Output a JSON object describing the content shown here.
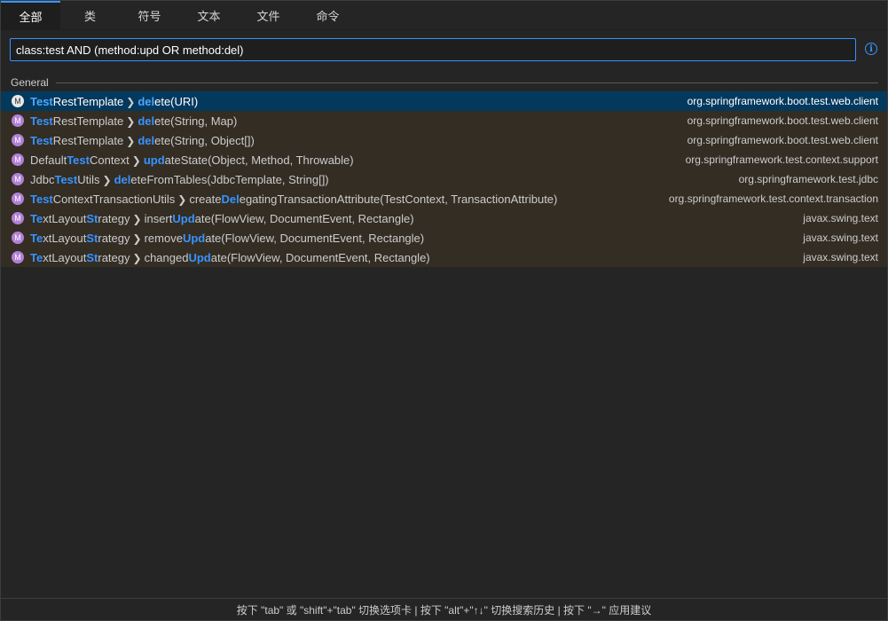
{
  "tabs": [
    {
      "label": "全部",
      "active": true
    },
    {
      "label": "类"
    },
    {
      "label": "符号"
    },
    {
      "label": "文本"
    },
    {
      "label": "文件"
    },
    {
      "label": "命令"
    }
  ],
  "search": {
    "value": "class:test AND (method:upd OR method:del)"
  },
  "icons": {
    "info": "info-icon",
    "method": "method-icon"
  },
  "group": {
    "label": "General"
  },
  "results": [
    {
      "icon_letter": "M",
      "class_parts": [
        [
          "Test",
          true
        ],
        [
          "RestTemplate",
          false
        ]
      ],
      "method_parts": [
        [
          "del",
          true
        ],
        [
          "ete(URI)",
          false
        ]
      ],
      "package": "org.springframework.boot.test.web.client",
      "selected": true
    },
    {
      "icon_letter": "M",
      "class_parts": [
        [
          "Test",
          true
        ],
        [
          "RestTemplate",
          false
        ]
      ],
      "method_parts": [
        [
          "del",
          true
        ],
        [
          "ete(String, Map)",
          false
        ]
      ],
      "package": "org.springframework.boot.test.web.client"
    },
    {
      "icon_letter": "M",
      "class_parts": [
        [
          "Test",
          true
        ],
        [
          "RestTemplate",
          false
        ]
      ],
      "method_parts": [
        [
          "del",
          true
        ],
        [
          "ete(String, Object[])",
          false
        ]
      ],
      "package": "org.springframework.boot.test.web.client"
    },
    {
      "icon_letter": "M",
      "class_parts": [
        [
          "Default",
          false
        ],
        [
          "Test",
          true
        ],
        [
          "Context",
          false
        ]
      ],
      "method_parts": [
        [
          "upd",
          true
        ],
        [
          "ateState(Object, Method, Throwable)",
          false
        ]
      ],
      "package": "org.springframework.test.context.support"
    },
    {
      "icon_letter": "M",
      "class_parts": [
        [
          "Jdbc",
          false
        ],
        [
          "Test",
          true
        ],
        [
          "Utils",
          false
        ]
      ],
      "method_parts": [
        [
          "del",
          true
        ],
        [
          "eteFromTables(JdbcTemplate, String[])",
          false
        ]
      ],
      "package": "org.springframework.test.jdbc"
    },
    {
      "icon_letter": "M",
      "class_parts": [
        [
          "Test",
          true
        ],
        [
          "ContextTransactionUtils",
          false
        ]
      ],
      "method_parts": [
        [
          "create",
          false
        ],
        [
          "Del",
          true
        ],
        [
          "egatingTransactionAttribute(TestContext, TransactionAttribute)",
          false
        ]
      ],
      "package": "org.springframework.test.context.transaction"
    },
    {
      "icon_letter": "M",
      "class_parts": [
        [
          "Te",
          true
        ],
        [
          "xtLayout",
          false
        ],
        [
          "St",
          true
        ],
        [
          "rategy",
          false
        ]
      ],
      "method_parts": [
        [
          "insert",
          false
        ],
        [
          "Upd",
          true
        ],
        [
          "ate(FlowView, DocumentEvent, Rectangle)",
          false
        ]
      ],
      "package": "javax.swing.text"
    },
    {
      "icon_letter": "M",
      "class_parts": [
        [
          "Te",
          true
        ],
        [
          "xtLayout",
          false
        ],
        [
          "St",
          true
        ],
        [
          "rategy",
          false
        ]
      ],
      "method_parts": [
        [
          "remove",
          false
        ],
        [
          "Upd",
          true
        ],
        [
          "ate(FlowView, DocumentEvent, Rectangle)",
          false
        ]
      ],
      "package": "javax.swing.text"
    },
    {
      "icon_letter": "M",
      "class_parts": [
        [
          "Te",
          true
        ],
        [
          "xtLayout",
          false
        ],
        [
          "St",
          true
        ],
        [
          "rategy",
          false
        ]
      ],
      "method_parts": [
        [
          "changed",
          false
        ],
        [
          "Upd",
          true
        ],
        [
          "ate(FlowView, DocumentEvent, Rectangle)",
          false
        ]
      ],
      "package": "javax.swing.text"
    }
  ],
  "separator": "❯",
  "footer": {
    "hint": "按下 \"tab\" 或 \"shift\"+\"tab\" 切换选项卡 | 按下 \"alt\"+\"↑↓\" 切换搜索历史 | 按下 \"→\" 应用建议"
  },
  "colors": {
    "accent": "#3794ff",
    "selected_row": "#04395e",
    "result_row": "#332d24",
    "method_icon": "#b180d7"
  }
}
